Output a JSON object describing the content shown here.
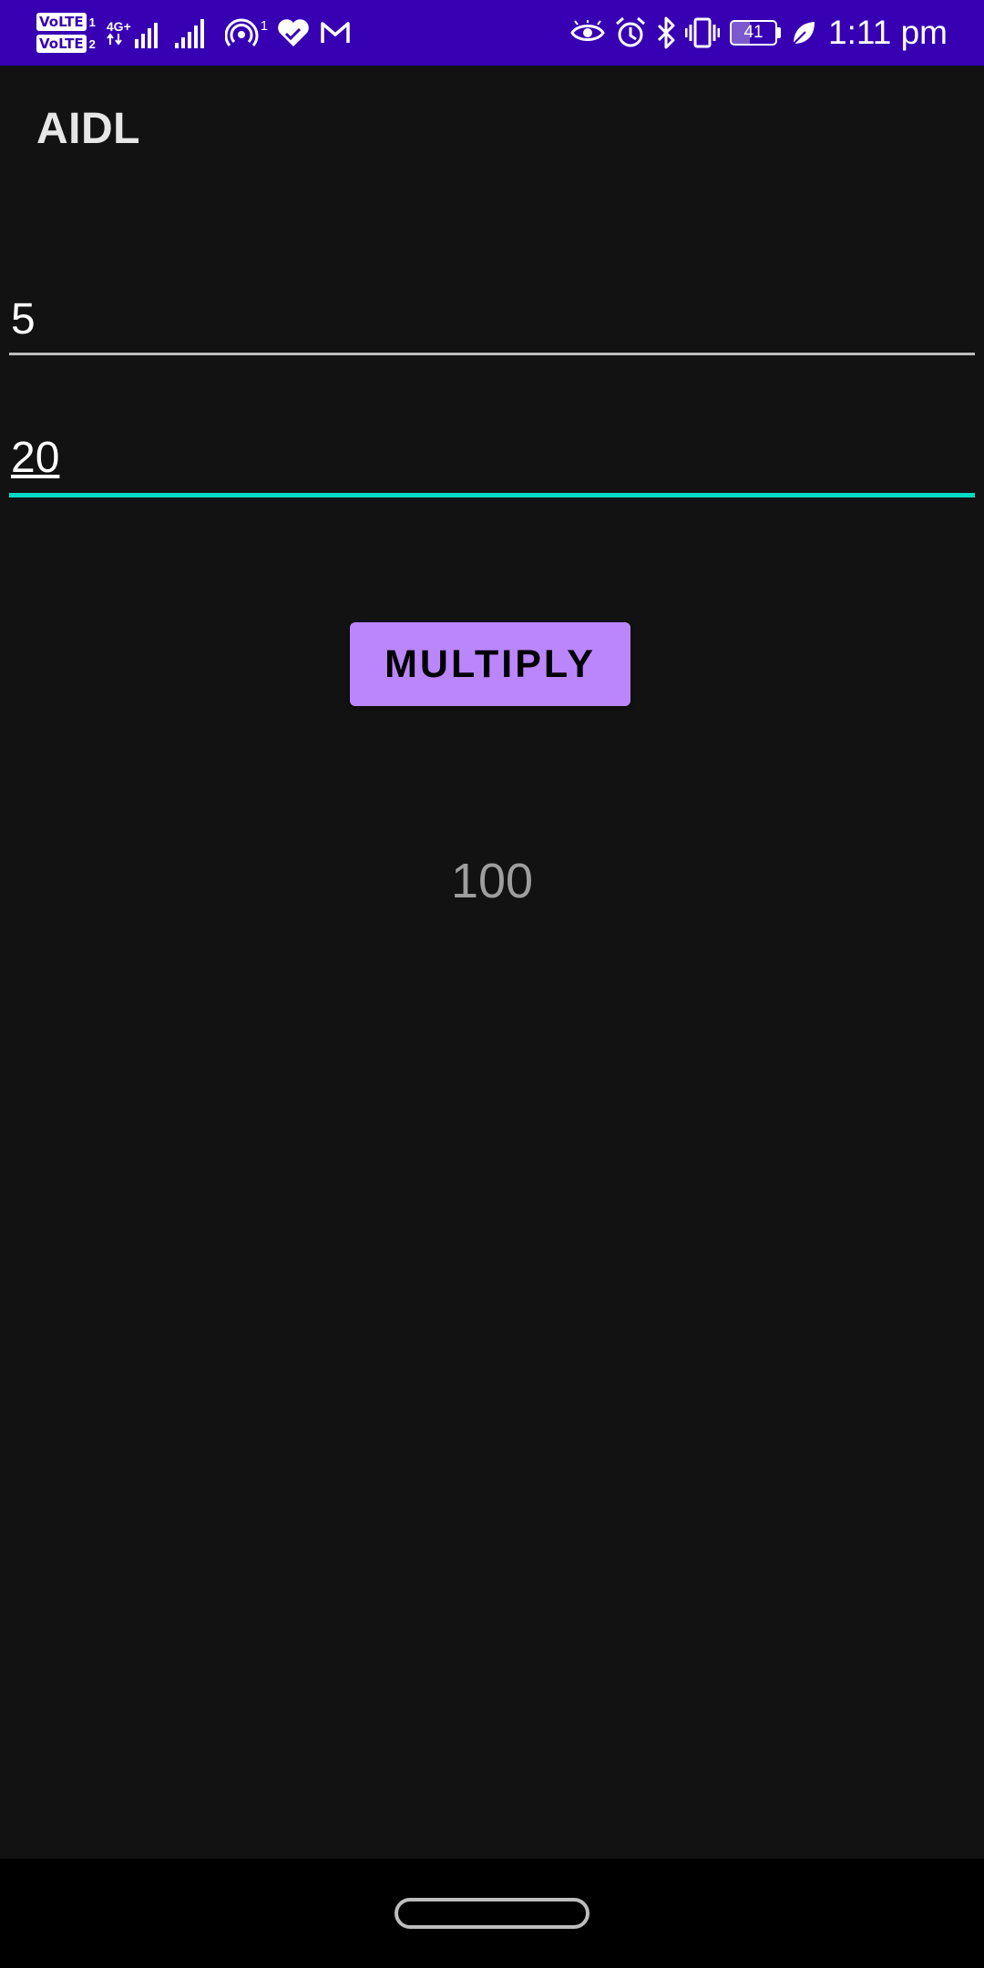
{
  "status_bar": {
    "sim1_badge": "VoLTE",
    "sim1_index": "1",
    "sim2_badge": "VoLTE",
    "sim2_index": "2",
    "network_type": "4G+",
    "hotspot_count": "1",
    "battery_level": "41",
    "time": "1:11 pm",
    "background_color": "#3700b3",
    "icons": [
      "signal-icon",
      "hotspot-icon",
      "health-icon",
      "gmail-icon",
      "eye-icon",
      "alarm-icon",
      "bluetooth-icon",
      "vibrate-icon",
      "battery-icon",
      "battery-saver-icon"
    ]
  },
  "app_bar": {
    "title": "AIDL"
  },
  "form": {
    "first_number": "5",
    "second_number": "20",
    "accent_color": "#03dac5"
  },
  "actions": {
    "multiply_label": "MULTIPLY",
    "button_color": "#bb86fc"
  },
  "result": {
    "value": "100"
  },
  "nav_bar": {
    "icons": [
      "home-pill-icon"
    ]
  }
}
